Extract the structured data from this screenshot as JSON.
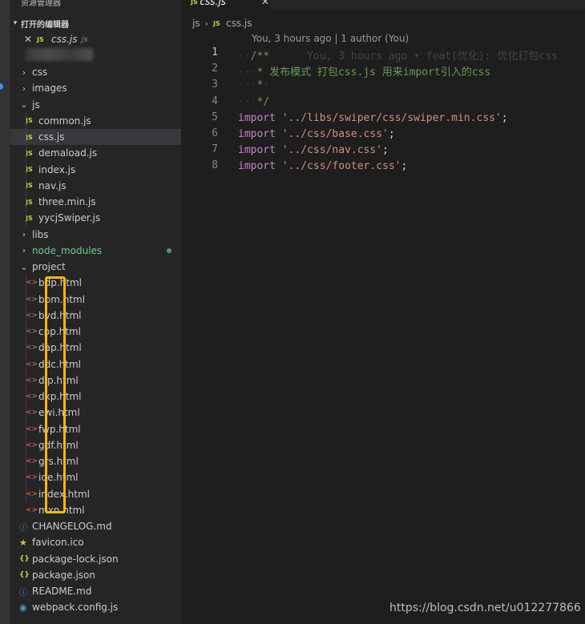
{
  "sidebar": {
    "title": "资源管理器",
    "open_editors_label": "打开的编辑器",
    "open_editor": {
      "close": "✕",
      "icon": "JS",
      "name": "css.js",
      "dir": "js"
    },
    "tree": [
      {
        "label": "css",
        "type": "folder",
        "state": "collapsed",
        "depth": 0
      },
      {
        "label": "images",
        "type": "folder",
        "state": "collapsed",
        "depth": 0
      },
      {
        "label": "js",
        "type": "folder",
        "state": "expanded",
        "depth": 0
      },
      {
        "label": "common.js",
        "type": "js",
        "depth": 1
      },
      {
        "label": "css.js",
        "type": "js",
        "depth": 1,
        "selected": true
      },
      {
        "label": "demaload.js",
        "type": "js",
        "depth": 1
      },
      {
        "label": "index.js",
        "type": "js",
        "depth": 1
      },
      {
        "label": "nav.js",
        "type": "js",
        "depth": 1
      },
      {
        "label": "three.min.js",
        "type": "js",
        "depth": 1
      },
      {
        "label": "yycjSwiper.js",
        "type": "js",
        "depth": 1
      },
      {
        "label": "libs",
        "type": "folder",
        "state": "collapsed",
        "depth": 0
      },
      {
        "label": "node_modules",
        "type": "folder",
        "state": "collapsed",
        "depth": 0,
        "green": true,
        "modified": true
      },
      {
        "label": "project",
        "type": "folder",
        "state": "expanded",
        "depth": 0
      },
      {
        "label": "bdp.html",
        "type": "html",
        "depth": 1
      },
      {
        "label": "bpm.html",
        "type": "html",
        "depth": 1
      },
      {
        "label": "bvd.html",
        "type": "html",
        "depth": 1
      },
      {
        "label": "cpp.html",
        "type": "html",
        "depth": 1
      },
      {
        "label": "dap.html",
        "type": "html",
        "depth": 1
      },
      {
        "label": "ddc.html",
        "type": "html",
        "depth": 1
      },
      {
        "label": "dip.html",
        "type": "html",
        "depth": 1
      },
      {
        "label": "dxp.html",
        "type": "html",
        "depth": 1
      },
      {
        "label": "ewi.html",
        "type": "html",
        "depth": 1
      },
      {
        "label": "fwp.html",
        "type": "html",
        "depth": 1
      },
      {
        "label": "gdf.html",
        "type": "html",
        "depth": 1
      },
      {
        "label": "grs.html",
        "type": "html",
        "depth": 1
      },
      {
        "label": "ide.html",
        "type": "html",
        "depth": 1
      },
      {
        "label": "index.html",
        "type": "html",
        "depth": 1
      },
      {
        "label": "mxn.html",
        "type": "html",
        "depth": 1
      },
      {
        "label": "CHANGELOG.md",
        "type": "md",
        "depth": 0
      },
      {
        "label": "favicon.ico",
        "type": "ico",
        "depth": 0
      },
      {
        "label": "package-lock.json",
        "type": "json",
        "depth": 0
      },
      {
        "label": "package.json",
        "type": "json",
        "depth": 0
      },
      {
        "label": "README.md",
        "type": "md",
        "depth": 0
      },
      {
        "label": "webpack.config.js",
        "type": "cfg",
        "depth": 0
      }
    ]
  },
  "tab": {
    "icon": "JS",
    "name": "css.js",
    "close": "✕"
  },
  "breadcrumb": {
    "folder": "js",
    "sep": "›",
    "icon": "JS",
    "file": "css.js"
  },
  "blame": "You, 3 hours ago | 1 author (You)",
  "editor": {
    "lines": [
      {
        "n": "1",
        "current": true,
        "parts": [
          [
            "ws",
            "··"
          ],
          [
            "cmt",
            "/**"
          ],
          [
            "inline-blame",
            "      You, 3 hours ago • feat(优化): 优化打包css"
          ]
        ]
      },
      {
        "n": "2",
        "parts": [
          [
            "ws",
            "···"
          ],
          [
            "cmt",
            "* 发布模式 打包css.js 用来import引入的css"
          ]
        ]
      },
      {
        "n": "3",
        "parts": [
          [
            "ws",
            "···"
          ],
          [
            "cmt",
            "*"
          ],
          [
            "ws",
            "·"
          ]
        ]
      },
      {
        "n": "4",
        "parts": [
          [
            "ws",
            "···"
          ],
          [
            "cmt",
            "*/"
          ]
        ]
      },
      {
        "n": "5",
        "parts": [
          [
            "kw",
            "import"
          ],
          [
            "punc",
            " "
          ],
          [
            "str",
            "'../libs/swiper/css/swiper.min.css'"
          ],
          [
            "punc",
            ";"
          ]
        ]
      },
      {
        "n": "6",
        "parts": [
          [
            "kw",
            "import"
          ],
          [
            "punc",
            " "
          ],
          [
            "str",
            "'../css/base.css'"
          ],
          [
            "punc",
            ";"
          ]
        ]
      },
      {
        "n": "7",
        "parts": [
          [
            "kw",
            "import"
          ],
          [
            "punc",
            " "
          ],
          [
            "str",
            "'../css/nav.css'"
          ],
          [
            "punc",
            ";"
          ]
        ]
      },
      {
        "n": "8",
        "parts": [
          [
            "kw",
            "import"
          ],
          [
            "punc",
            " "
          ],
          [
            "str",
            "'../css/footer.css'"
          ],
          [
            "punc",
            ";"
          ]
        ]
      }
    ]
  },
  "watermark": "https://blog.csdn.net/u012277866",
  "colors": {
    "highlight": "#f5b80c",
    "js_icon": "#cbcb41",
    "html_icon": "#e37933",
    "green_folder": "#73c991"
  }
}
